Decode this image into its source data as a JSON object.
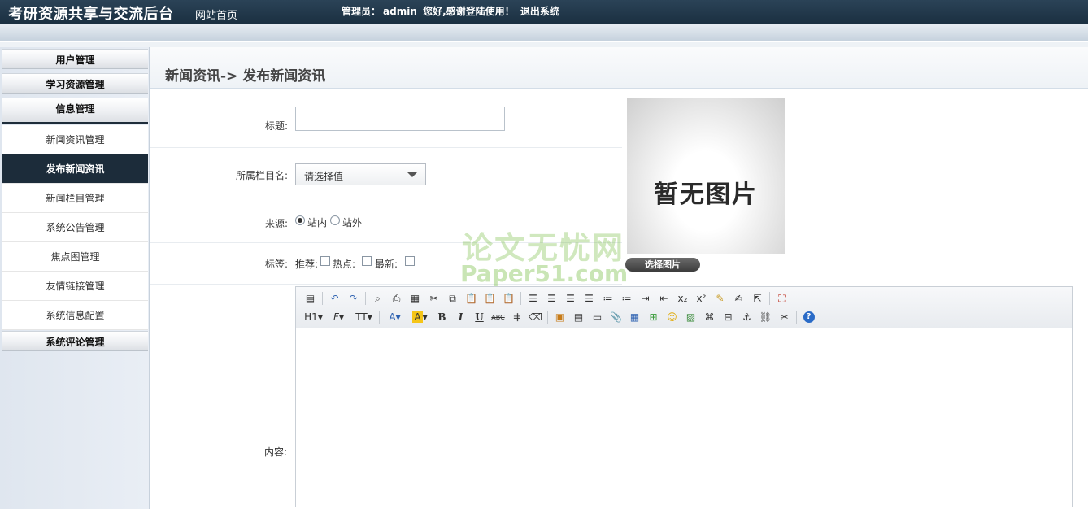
{
  "header": {
    "site_title": "考研资源共享与交流后台",
    "home_link": "网站首页",
    "admin_label": "管理员：",
    "admin_name": "admin",
    "welcome": "您好,感谢登陆使用！",
    "logout": "退出系统"
  },
  "sidebar": {
    "sections": [
      {
        "label": "用户管理"
      },
      {
        "label": "学习资源管理"
      },
      {
        "label": "信息管理"
      },
      {
        "label": "系统评论管理"
      }
    ],
    "items": [
      {
        "label": "新闻资讯管理"
      },
      {
        "label": "发布新闻资讯"
      },
      {
        "label": "新闻栏目管理"
      },
      {
        "label": "系统公告管理"
      },
      {
        "label": "焦点图管理"
      },
      {
        "label": "友情链接管理"
      },
      {
        "label": "系统信息配置"
      }
    ]
  },
  "main": {
    "breadcrumb": "新闻资讯-> 发布新闻资讯",
    "form": {
      "title_label": "标题:",
      "title_value": "",
      "category_label": "所属栏目名:",
      "category_value": "请选择值",
      "source_label": "来源:",
      "source_options": [
        "站内",
        "站外"
      ],
      "source_selected": "站内",
      "tags_label": "标签:",
      "tag_recommend": "推荐:",
      "tag_hot": "热点:",
      "tag_new": "最新:",
      "content_label": "内容:"
    },
    "preview": {
      "no_image_text": "暂无图片",
      "choose_button": "选择图片"
    },
    "watermark": {
      "line1": "论文无忧网",
      "line2": "Paper51.com"
    },
    "toolbar": {
      "heading": "H1",
      "font": "F",
      "font_size": "TT",
      "font_color": "A",
      "highlight": "A",
      "bold": "B",
      "italic": "I",
      "underline": "U",
      "strike": "ABC",
      "subscript": "x₂",
      "superscript": "x²",
      "help": "?"
    }
  },
  "colors": {
    "header_bg": "#1f3446",
    "active_item_bg": "#1c2c3a",
    "sidebar_bg": "#e3e9f0"
  }
}
